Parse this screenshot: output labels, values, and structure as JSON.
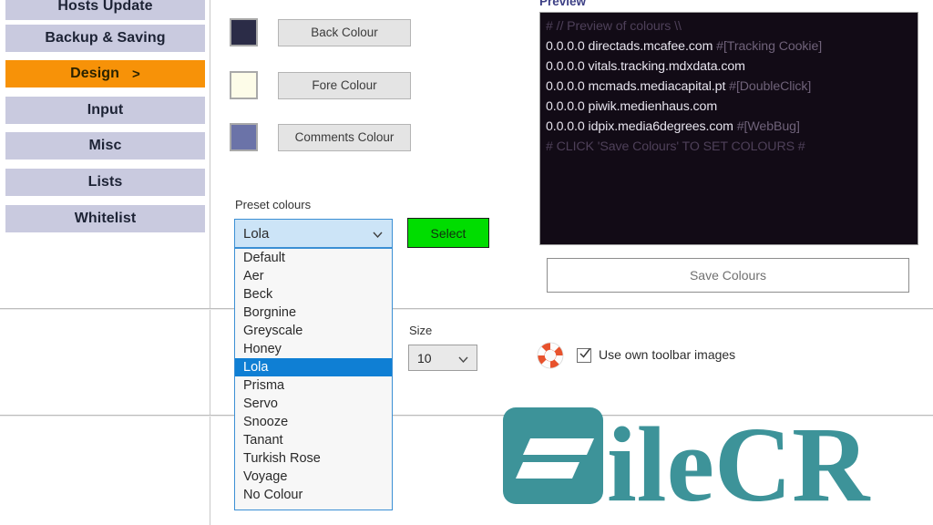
{
  "sidebar": {
    "items": [
      {
        "label": "Hosts Update",
        "active": false,
        "chevron": ""
      },
      {
        "label": "Backup & Saving",
        "active": false,
        "chevron": ""
      },
      {
        "label": "Design",
        "active": true,
        "chevron": ">"
      },
      {
        "label": "Input",
        "active": false,
        "chevron": ""
      },
      {
        "label": "Misc",
        "active": false,
        "chevron": ""
      },
      {
        "label": "Lists",
        "active": false,
        "chevron": ""
      },
      {
        "label": "Whitelist",
        "active": false,
        "chevron": ""
      }
    ]
  },
  "colours": {
    "back": {
      "label": "Back Colour",
      "swatch": "#2b2c47"
    },
    "fore": {
      "label": "Fore Colour",
      "swatch": "#fdfce8"
    },
    "comments": {
      "label": "Comments Colour",
      "swatch": "#6b73a8"
    }
  },
  "preset": {
    "label": "Preset colours",
    "selected": "Lola",
    "select_button": "Select",
    "options": [
      "Default",
      "Aer",
      "Beck",
      "Borgnine",
      "Greyscale",
      "Honey",
      "Lola",
      "Prisma",
      "Servo",
      "Snooze",
      "Tanant",
      "Turkish Rose",
      "Voyage",
      "No Colour"
    ],
    "highlighted": "Lola"
  },
  "size": {
    "label": "Size",
    "value": "10"
  },
  "toolbar_images": {
    "label": "Use own toolbar images",
    "checked": true,
    "icon": "lifebuoy-icon"
  },
  "preview": {
    "label": "Preview",
    "background": "#120b16",
    "lines": [
      {
        "type": "comment",
        "text": "# // Preview of colours \\\\"
      },
      {
        "type": "host",
        "host": "0.0.0.0 directads.mcafee.com",
        "tag": "#[Tracking Cookie]"
      },
      {
        "type": "host",
        "host": "0.0.0.0 vitals.tracking.mdxdata.com",
        "tag": ""
      },
      {
        "type": "host",
        "host": "0.0.0.0 mcmads.mediacapital.pt",
        "tag": "#[DoubleClick]"
      },
      {
        "type": "host",
        "host": "0.0.0.0 piwik.medienhaus.com",
        "tag": ""
      },
      {
        "type": "host",
        "host": "0.0.0.0 idpix.media6degrees.com",
        "tag": "#[WebBug]"
      },
      {
        "type": "comment",
        "text": "# CLICK 'Save Colours' TO SET COLOURS #"
      }
    ]
  },
  "save_colours": {
    "label": "Save Colours"
  },
  "watermark": {
    "text": "FileCR",
    "colour": "#3d9399"
  },
  "accents": {
    "active_item": "#f79208",
    "sidebar_item": "#c9cadf",
    "select_button": "#00dd00",
    "combo_focus": "#cce4f7",
    "list_highlight": "#0f7fd4"
  }
}
